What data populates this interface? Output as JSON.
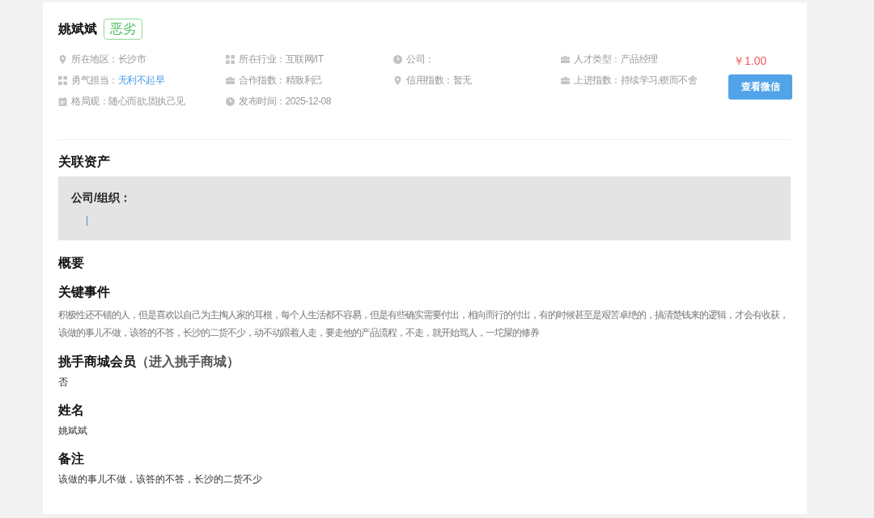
{
  "profile": {
    "name": "姚斌斌",
    "tag": "恶劣",
    "info": [
      {
        "kind": "pin",
        "label": "所在地区：",
        "value": "长沙市",
        "link": false
      },
      {
        "kind": "grid",
        "label": "所在行业：",
        "value": "互联网/IT",
        "link": false
      },
      {
        "kind": "clock",
        "label": "公司："
      },
      {
        "kind": "case",
        "label": "人才类型：",
        "value": "产品经理",
        "link": false
      },
      {
        "kind": "grid",
        "label": "勇气担当：",
        "value": "无利不起早",
        "link": true
      },
      {
        "kind": "case",
        "label": "合作指数：",
        "value": "精致利己",
        "link": false
      },
      {
        "kind": "pin",
        "label": "信用指数：",
        "value": "暂无",
        "link": false
      },
      {
        "kind": "case",
        "label": "上进指数：",
        "value": "持续学习,锲而不舍",
        "link": false
      },
      {
        "kind": "note",
        "label": "格局观：",
        "value": "随心而欲,固执己见",
        "link": false
      },
      {
        "kind": "clock",
        "label": "发布时间：",
        "value": "2025-12-08",
        "link": false
      }
    ],
    "price": "￥1.00",
    "button": "查看微信"
  },
  "related_assets": {
    "title": "关联资产",
    "box_label": "公司/组织：",
    "separator": "|"
  },
  "overview": {
    "title": "概要"
  },
  "sections": [
    {
      "kind": "description",
      "title": "关键事件",
      "text": "积极性还不错的人，但是喜欢以自己为主掏人家的耳根，每个人生活都不容易，但是有些确实需要付出，相向而行的付出，有的时候甚至是艰苦卓绝的，搞清楚钱来的逻辑，才会有收获，该做的事儿不做，该答的不答，长沙的二货不少，动不动跟着人走，要走他的产品流程，不走，就开始骂人，一坨屎的修养"
    },
    {
      "kind": "value",
      "title": "挑手商城会员",
      "link": "（进入挑手商城）",
      "text": "否"
    },
    {
      "kind": "value",
      "title": "姓名",
      "text": "姚斌斌"
    },
    {
      "kind": "value",
      "title": "备注",
      "text": "该做的事儿不做，该答的不答，长沙的二货不少"
    }
  ]
}
